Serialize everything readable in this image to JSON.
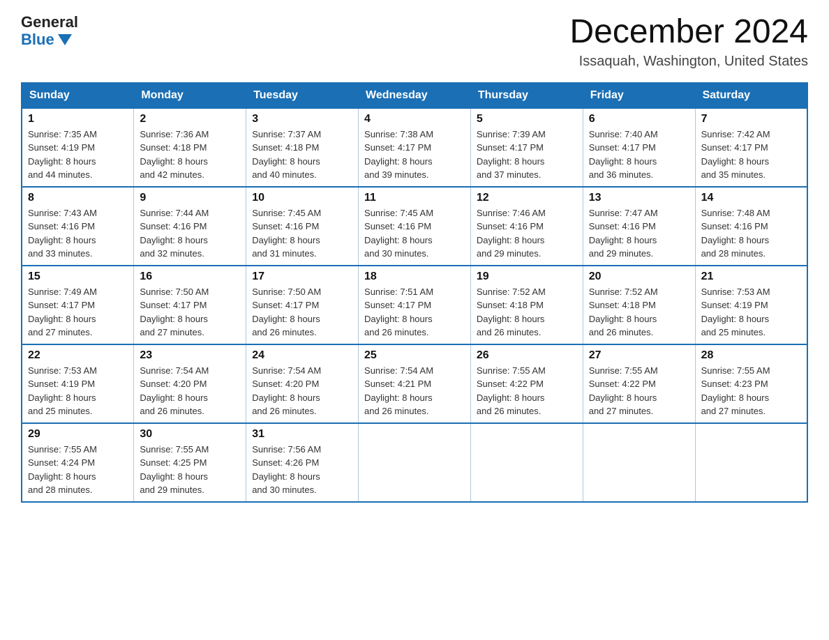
{
  "logo": {
    "general": "General",
    "blue": "Blue"
  },
  "title": "December 2024",
  "location": "Issaquah, Washington, United States",
  "days_of_week": [
    "Sunday",
    "Monday",
    "Tuesday",
    "Wednesday",
    "Thursday",
    "Friday",
    "Saturday"
  ],
  "weeks": [
    [
      {
        "day": "1",
        "sunrise": "7:35 AM",
        "sunset": "4:19 PM",
        "daylight": "8 hours and 44 minutes."
      },
      {
        "day": "2",
        "sunrise": "7:36 AM",
        "sunset": "4:18 PM",
        "daylight": "8 hours and 42 minutes."
      },
      {
        "day": "3",
        "sunrise": "7:37 AM",
        "sunset": "4:18 PM",
        "daylight": "8 hours and 40 minutes."
      },
      {
        "day": "4",
        "sunrise": "7:38 AM",
        "sunset": "4:17 PM",
        "daylight": "8 hours and 39 minutes."
      },
      {
        "day": "5",
        "sunrise": "7:39 AM",
        "sunset": "4:17 PM",
        "daylight": "8 hours and 37 minutes."
      },
      {
        "day": "6",
        "sunrise": "7:40 AM",
        "sunset": "4:17 PM",
        "daylight": "8 hours and 36 minutes."
      },
      {
        "day": "7",
        "sunrise": "7:42 AM",
        "sunset": "4:17 PM",
        "daylight": "8 hours and 35 minutes."
      }
    ],
    [
      {
        "day": "8",
        "sunrise": "7:43 AM",
        "sunset": "4:16 PM",
        "daylight": "8 hours and 33 minutes."
      },
      {
        "day": "9",
        "sunrise": "7:44 AM",
        "sunset": "4:16 PM",
        "daylight": "8 hours and 32 minutes."
      },
      {
        "day": "10",
        "sunrise": "7:45 AM",
        "sunset": "4:16 PM",
        "daylight": "8 hours and 31 minutes."
      },
      {
        "day": "11",
        "sunrise": "7:45 AM",
        "sunset": "4:16 PM",
        "daylight": "8 hours and 30 minutes."
      },
      {
        "day": "12",
        "sunrise": "7:46 AM",
        "sunset": "4:16 PM",
        "daylight": "8 hours and 29 minutes."
      },
      {
        "day": "13",
        "sunrise": "7:47 AM",
        "sunset": "4:16 PM",
        "daylight": "8 hours and 29 minutes."
      },
      {
        "day": "14",
        "sunrise": "7:48 AM",
        "sunset": "4:16 PM",
        "daylight": "8 hours and 28 minutes."
      }
    ],
    [
      {
        "day": "15",
        "sunrise": "7:49 AM",
        "sunset": "4:17 PM",
        "daylight": "8 hours and 27 minutes."
      },
      {
        "day": "16",
        "sunrise": "7:50 AM",
        "sunset": "4:17 PM",
        "daylight": "8 hours and 27 minutes."
      },
      {
        "day": "17",
        "sunrise": "7:50 AM",
        "sunset": "4:17 PM",
        "daylight": "8 hours and 26 minutes."
      },
      {
        "day": "18",
        "sunrise": "7:51 AM",
        "sunset": "4:17 PM",
        "daylight": "8 hours and 26 minutes."
      },
      {
        "day": "19",
        "sunrise": "7:52 AM",
        "sunset": "4:18 PM",
        "daylight": "8 hours and 26 minutes."
      },
      {
        "day": "20",
        "sunrise": "7:52 AM",
        "sunset": "4:18 PM",
        "daylight": "8 hours and 26 minutes."
      },
      {
        "day": "21",
        "sunrise": "7:53 AM",
        "sunset": "4:19 PM",
        "daylight": "8 hours and 25 minutes."
      }
    ],
    [
      {
        "day": "22",
        "sunrise": "7:53 AM",
        "sunset": "4:19 PM",
        "daylight": "8 hours and 25 minutes."
      },
      {
        "day": "23",
        "sunrise": "7:54 AM",
        "sunset": "4:20 PM",
        "daylight": "8 hours and 26 minutes."
      },
      {
        "day": "24",
        "sunrise": "7:54 AM",
        "sunset": "4:20 PM",
        "daylight": "8 hours and 26 minutes."
      },
      {
        "day": "25",
        "sunrise": "7:54 AM",
        "sunset": "4:21 PM",
        "daylight": "8 hours and 26 minutes."
      },
      {
        "day": "26",
        "sunrise": "7:55 AM",
        "sunset": "4:22 PM",
        "daylight": "8 hours and 26 minutes."
      },
      {
        "day": "27",
        "sunrise": "7:55 AM",
        "sunset": "4:22 PM",
        "daylight": "8 hours and 27 minutes."
      },
      {
        "day": "28",
        "sunrise": "7:55 AM",
        "sunset": "4:23 PM",
        "daylight": "8 hours and 27 minutes."
      }
    ],
    [
      {
        "day": "29",
        "sunrise": "7:55 AM",
        "sunset": "4:24 PM",
        "daylight": "8 hours and 28 minutes."
      },
      {
        "day": "30",
        "sunrise": "7:55 AM",
        "sunset": "4:25 PM",
        "daylight": "8 hours and 29 minutes."
      },
      {
        "day": "31",
        "sunrise": "7:56 AM",
        "sunset": "4:26 PM",
        "daylight": "8 hours and 30 minutes."
      },
      null,
      null,
      null,
      null
    ]
  ],
  "labels": {
    "sunrise": "Sunrise:",
    "sunset": "Sunset:",
    "daylight": "Daylight:"
  }
}
